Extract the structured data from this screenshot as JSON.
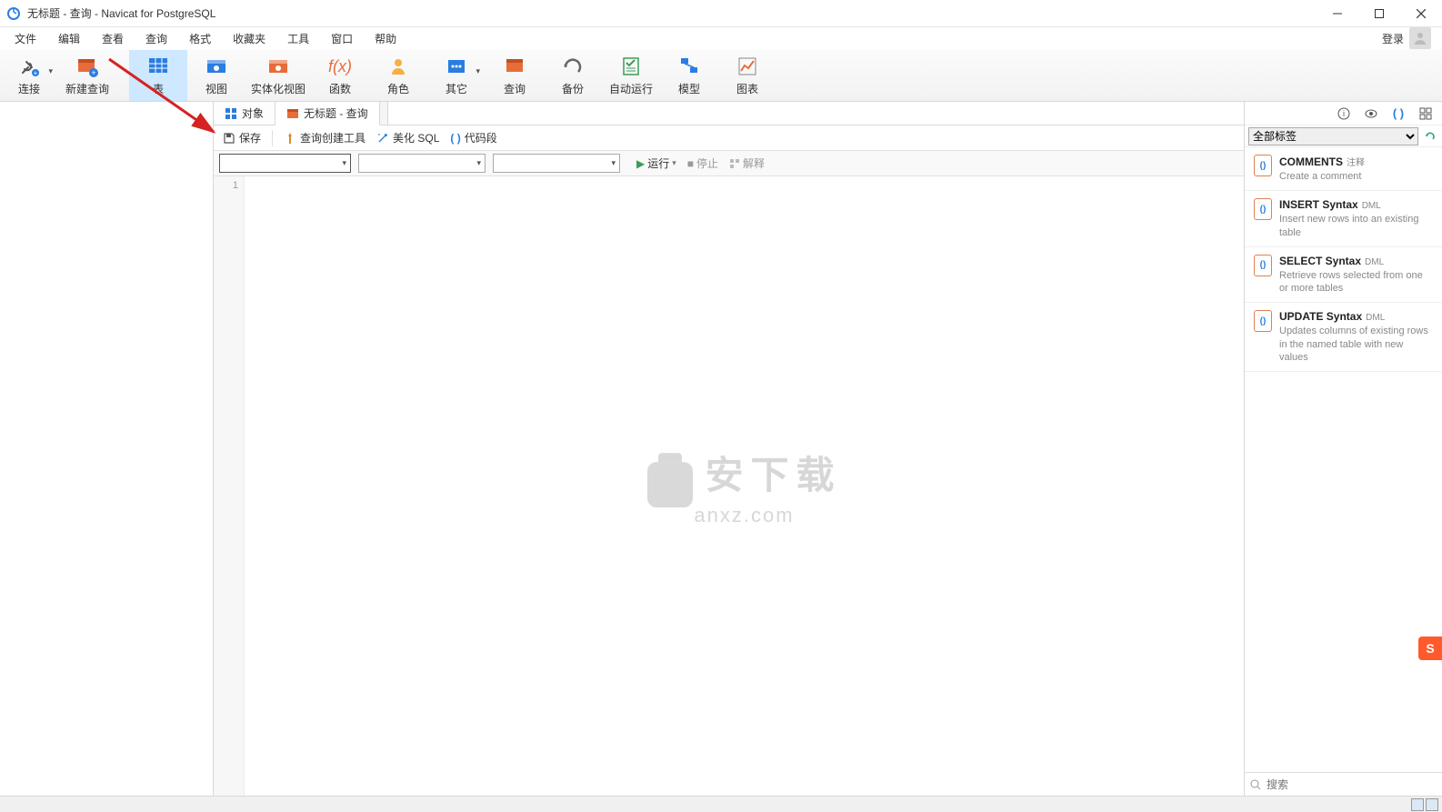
{
  "window": {
    "title": "无标题 - 查询 - Navicat for PostgreSQL"
  },
  "menu": {
    "items": [
      "文件",
      "编辑",
      "查看",
      "查询",
      "格式",
      "收藏夹",
      "工具",
      "窗口",
      "帮助"
    ],
    "login": "登录"
  },
  "toolbar": {
    "items": [
      {
        "label": "连接",
        "icon": "plug",
        "dropdown": true
      },
      {
        "label": "新建查询",
        "icon": "newquery"
      },
      {
        "label": "表",
        "icon": "table",
        "active": true
      },
      {
        "label": "视图",
        "icon": "view"
      },
      {
        "label": "实体化视图",
        "icon": "matview"
      },
      {
        "label": "函数",
        "icon": "fx"
      },
      {
        "label": "角色",
        "icon": "role"
      },
      {
        "label": "其它",
        "icon": "other",
        "dropdown": true
      },
      {
        "label": "查询",
        "icon": "query"
      },
      {
        "label": "备份",
        "icon": "backup"
      },
      {
        "label": "自动运行",
        "icon": "auto"
      },
      {
        "label": "模型",
        "icon": "model"
      },
      {
        "label": "图表",
        "icon": "chart"
      }
    ]
  },
  "tabs": {
    "items": [
      {
        "label": "对象",
        "icon": "objects"
      },
      {
        "label": "无标题 - 查询",
        "icon": "query",
        "active": true
      }
    ]
  },
  "editor_toolbar": {
    "save": "保存",
    "query_builder": "查询创建工具",
    "beautify": "美化 SQL",
    "snippet": "代码段"
  },
  "run_row": {
    "run": "运行",
    "stop": "停止",
    "explain": "解释"
  },
  "editor": {
    "line_number": "1",
    "watermark_top": "安下载",
    "watermark_bottom": "anxz.com"
  },
  "right_panel": {
    "filter_label": "全部标签",
    "search_placeholder": "搜索",
    "snippets": [
      {
        "title": "COMMENTS",
        "tag": "注释",
        "desc": "Create a comment"
      },
      {
        "title": "INSERT Syntax",
        "tag": "DML",
        "desc": "Insert new rows into an existing table"
      },
      {
        "title": "SELECT Syntax",
        "tag": "DML",
        "desc": "Retrieve rows selected from one or more tables"
      },
      {
        "title": "UPDATE Syntax",
        "tag": "DML",
        "desc": "Updates columns of existing rows in the named table with new values"
      }
    ]
  }
}
